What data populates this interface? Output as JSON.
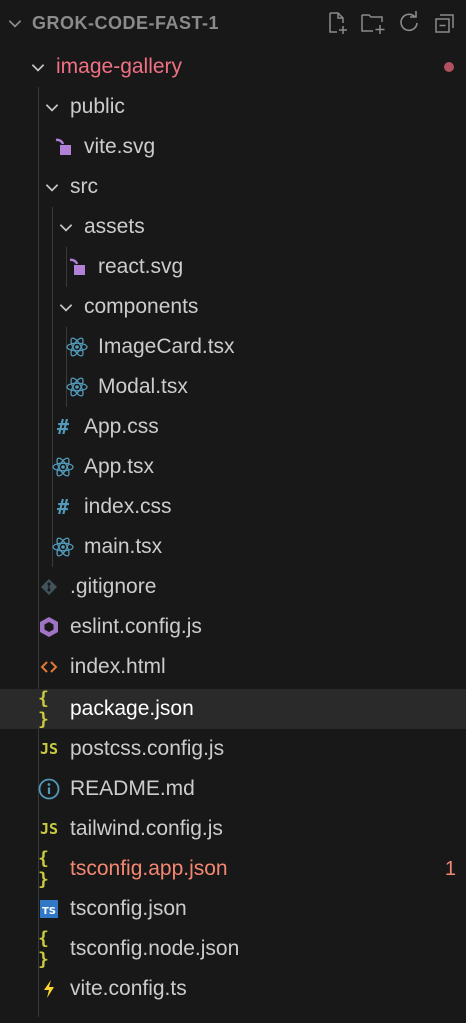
{
  "explorer": {
    "title": "GROK-CODE-FAST-1",
    "actions": {
      "new_file_icon": "new-file-icon",
      "new_folder_icon": "new-folder-icon",
      "refresh_icon": "refresh-icon",
      "collapse_icon": "collapse-all-icon"
    }
  },
  "tree": {
    "root": {
      "label": "image-gallery",
      "status_color": "#b05061"
    },
    "public": {
      "label": "public"
    },
    "vite_svg": {
      "label": "vite.svg"
    },
    "src": {
      "label": "src"
    },
    "assets": {
      "label": "assets"
    },
    "react_svg": {
      "label": "react.svg"
    },
    "components": {
      "label": "components"
    },
    "imagecard": {
      "label": "ImageCard.tsx"
    },
    "modal": {
      "label": "Modal.tsx"
    },
    "app_css": {
      "label": "App.css"
    },
    "app_tsx": {
      "label": "App.tsx"
    },
    "index_css": {
      "label": "index.css"
    },
    "main_tsx": {
      "label": "main.tsx"
    },
    "gitignore": {
      "label": ".gitignore"
    },
    "eslint": {
      "label": "eslint.config.js"
    },
    "index_html": {
      "label": "index.html"
    },
    "package_json": {
      "label": "package.json",
      "selected": true
    },
    "postcss": {
      "label": "postcss.config.js"
    },
    "readme": {
      "label": "README.md"
    },
    "tailwind": {
      "label": "tailwind.config.js"
    },
    "tsconfig_app": {
      "label": "tsconfig.app.json",
      "problems": "1"
    },
    "tsconfig": {
      "label": "tsconfig.json"
    },
    "tsconfig_node": {
      "label": "tsconfig.node.json"
    },
    "vite_config": {
      "label": "vite.config.ts"
    }
  },
  "icon_text": {
    "hash": "#",
    "braces": "{ }",
    "js": "JS",
    "ts": "TS"
  },
  "colors": {
    "background": "#181818",
    "selected_row": "#2a2a2a",
    "error_text": "#f48771",
    "svg_icon": "#b180d7",
    "react_icon": "#519aba",
    "json_icon": "#cbcb41",
    "html_icon": "#e37933",
    "ts_icon": "#3178c6",
    "vite_icon": "#ffd62e"
  }
}
